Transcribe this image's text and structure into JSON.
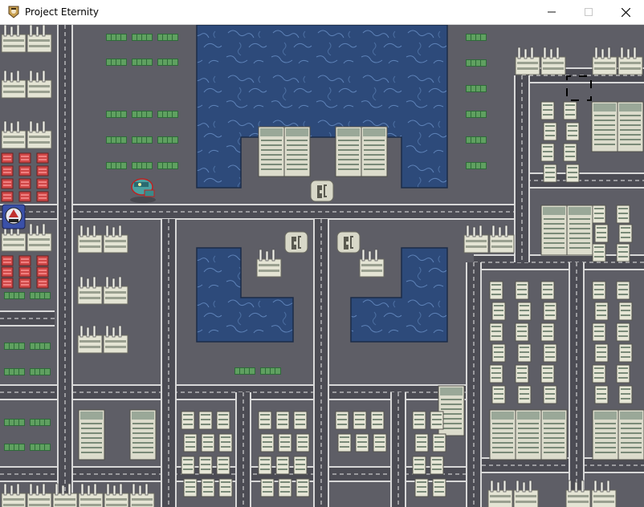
{
  "window": {
    "title": "Project Eternity",
    "app_icon": "project-eternity-icon",
    "controls": {
      "minimize": "minimize-icon",
      "maximize": "maximize-icon",
      "close": "close-icon"
    }
  },
  "map": {
    "sprites": {
      "player": "robot-pilot-character",
      "npc": "mecha-creature-unit"
    },
    "colors": {
      "ground": "#5e5e66",
      "road": "#4c4c54",
      "curb": "#d8d8d8",
      "lane_line": "#e8e8e8",
      "water": "#2d4a7a",
      "water_pattern": "#5d82b8",
      "building": "#dcdccc",
      "building_window": "#7a8a78",
      "hedge": "#3f7f4a",
      "red_block": "#d04848"
    }
  }
}
